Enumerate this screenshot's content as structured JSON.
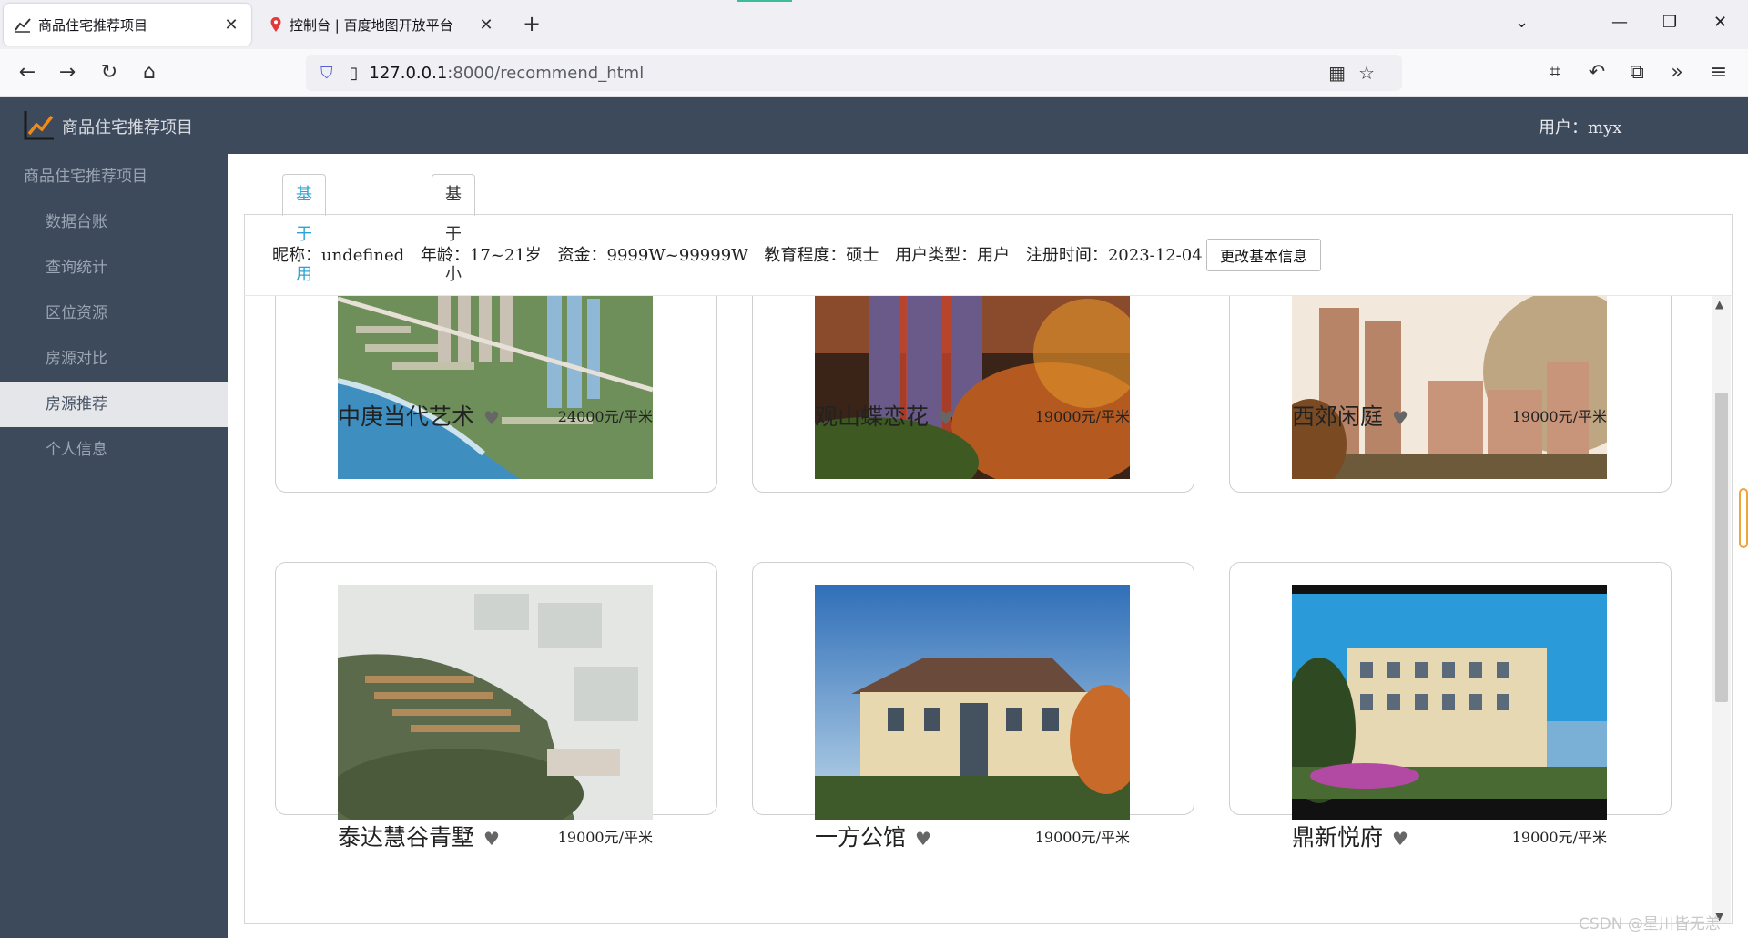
{
  "browser": {
    "tabs": [
      {
        "title": "商品住宅推荐项目",
        "active": true
      },
      {
        "title": "控制台 | 百度地图开放平台",
        "active": false
      }
    ],
    "url": {
      "host": "127.0.0.1",
      "path": ":8000/recommend_html"
    }
  },
  "app": {
    "title": "商品住宅推荐项目",
    "user_label": "用户：myx"
  },
  "sidebar": {
    "head": "商品住宅推荐项目",
    "items": [
      {
        "label": "数据台账"
      },
      {
        "label": "查询统计"
      },
      {
        "label": "区位资源"
      },
      {
        "label": "房源对比"
      },
      {
        "label": "房源推荐",
        "active": true
      },
      {
        "label": "个人信息"
      }
    ]
  },
  "tabs": {
    "user_based": "基于用户推荐",
    "community_based": "基于小区推荐"
  },
  "profile": {
    "nickname": "昵称：undefined",
    "age": "年龄：17~21岁",
    "funds": "资金：9999W~99999W",
    "education": "教育程度：硕士",
    "user_type": "用户类型：用户",
    "register_time": "注册时间：2023-12-04",
    "edit_button": "更改基本信息"
  },
  "listings": [
    {
      "name": "中庚当代艺术",
      "price": "24000元/平米"
    },
    {
      "name": "观山蝶恋花",
      "price": "19000元/平米"
    },
    {
      "name": "西郊闲庭",
      "price": "19000元/平米"
    },
    {
      "name": "泰达慧谷青墅",
      "price": "19000元/平米"
    },
    {
      "name": "一方公馆",
      "price": "19000元/平米"
    },
    {
      "name": "鼎新悦府",
      "price": "19000元/平米"
    }
  ],
  "watermark": "CSDN @星川皆无恙",
  "colors": {
    "header_bg": "#3d4a5b",
    "accent": "#2aa4d7",
    "active_side": "#e4e6ea"
  }
}
